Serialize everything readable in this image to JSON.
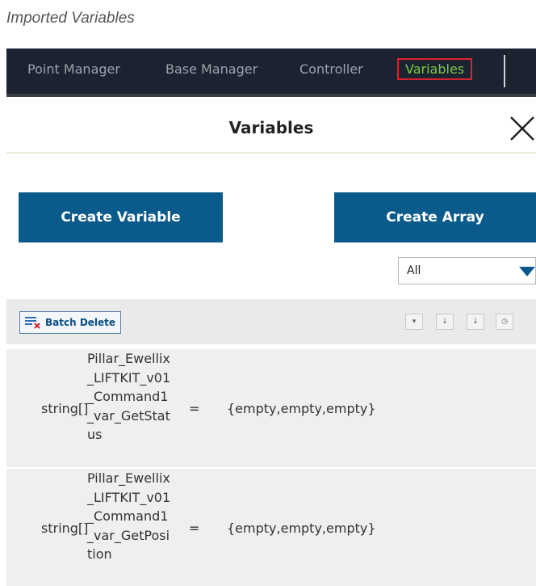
{
  "caption": "Imported Variables",
  "nav": {
    "tabs": [
      {
        "label": "Point Manager"
      },
      {
        "label": "Base Manager"
      },
      {
        "label": "Controller"
      },
      {
        "label": "Variables"
      }
    ],
    "active_color": "#7ac943"
  },
  "dialog": {
    "title": "Variables",
    "create_variable": "Create Variable",
    "create_array": "Create Array",
    "filter": {
      "selected": "All"
    },
    "batch_delete": "Batch Delete",
    "sort_icons": [
      "sort-by-var-icon",
      "sort-z-a-icon",
      "sort-a-z-icon",
      "sort-by-time-icon"
    ],
    "variables": [
      {
        "type": "string[]",
        "name_lines": [
          "Pillar_Ewellix",
          "_LIFTKIT_v01",
          "_Command1",
          "_var_GetStat",
          "us"
        ],
        "equals": "=",
        "value": "{empty,empty,empty}"
      },
      {
        "type": "string[]",
        "name_lines": [
          "Pillar_Ewellix",
          "_LIFTKIT_v01",
          "_Command1",
          "_var_GetPosi",
          "tion"
        ],
        "equals": "=",
        "value": "{empty,empty,empty}"
      }
    ]
  },
  "colors": {
    "nav_bg": "#1c2330",
    "primary": "#0a5b8b",
    "highlight_border": "#d9232d"
  }
}
